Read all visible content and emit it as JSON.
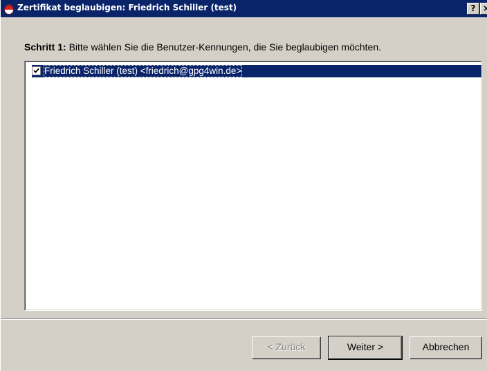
{
  "window": {
    "title": "Zertifikat beglaubigen: Friedrich Schiller (test)",
    "help_label": "?",
    "close_label": "×"
  },
  "step": {
    "label": "Schritt 1:",
    "text": " Bitte wählen Sie die Benutzer-Kennungen, die Sie beglaubigen möchten."
  },
  "user_ids": [
    {
      "label": "Friedrich Schiller (test) <friedrich@gpg4win.de>",
      "checked": true,
      "selected": true
    }
  ],
  "buttons": {
    "back_label": "< Zurück",
    "next_label": "Weiter >",
    "cancel_label": "Abbrechen"
  },
  "colors": {
    "titlebar": "#0a246a",
    "selection": "#0a246a",
    "dialog_bg": "#d4d0c8"
  },
  "icons": {
    "app_icon": "gpg4win-icon",
    "check_icon": "checkmark-icon"
  }
}
